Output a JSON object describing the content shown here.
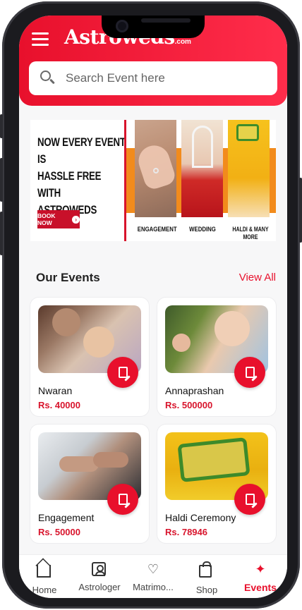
{
  "header": {
    "brand": "Astroweds",
    "brand_suffix": ".com",
    "search_placeholder": "Search Event here"
  },
  "banner": {
    "headline_lines": [
      "NOW EVERY EVENT IS",
      "HASSLE FREE WITH",
      "ASTROWEDS"
    ],
    "cta": "BOOK NOW",
    "captions": [
      "ENGAGEMENT",
      "WEDDING",
      "HALDI & MANY MORE"
    ]
  },
  "events_section": {
    "title": "Our Events",
    "view_all": "View All"
  },
  "events": [
    {
      "name": "Nwaran",
      "price": "Rs. 40000"
    },
    {
      "name": "Annaprashan",
      "price": "Rs. 500000"
    },
    {
      "name": "Engagement",
      "price": "Rs. 50000"
    },
    {
      "name": "Haldi Ceremony",
      "price": "Rs. 78946"
    }
  ],
  "bottom_nav": [
    {
      "label": "Home",
      "icon": "home-icon"
    },
    {
      "label": "Astrologer",
      "icon": "profile-icon"
    },
    {
      "label": "Matrimo...",
      "icon": "heart-hand-icon"
    },
    {
      "label": "Shop",
      "icon": "shopping-bag-icon"
    },
    {
      "label": "Events",
      "icon": "party-popper-icon",
      "active": true
    }
  ],
  "colors": {
    "accent": "#e8102c",
    "price": "#d8142c"
  }
}
